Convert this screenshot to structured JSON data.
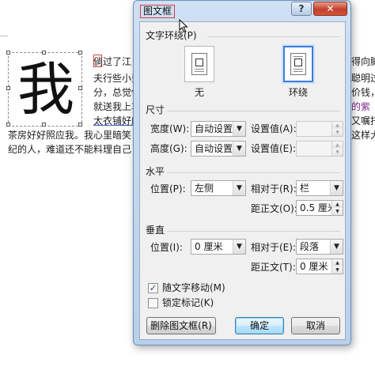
{
  "document": {
    "frame_char": "我",
    "lines": [
      "倘过了江，",
      "夫行些小费",
      "分，总觉他",
      "就送我上车",
      "太衣铺好座",
      "茶房好好照应我。我心里暗笑",
      "纪的人，难道还不能料理自己"
    ],
    "right_fragments": [
      "得向脚",
      "聪明过",
      "价钱，",
      "的紫",
      "又嘱托",
      "这样大",
      ""
    ]
  },
  "dialog": {
    "title": "图文框",
    "help_label": "?",
    "close_label": "✕",
    "wrap_section": "文字环绕(P)",
    "wrap_options": [
      {
        "label": "无",
        "selected": false
      },
      {
        "label": "环绕",
        "selected": true
      }
    ],
    "size_section": "尺寸",
    "width_label": "宽度(W):",
    "width_value": "自动设置",
    "width_setting_label": "设置值(A):",
    "width_setting_value": "",
    "height_label": "高度(G):",
    "height_value": "自动设置",
    "height_setting_label": "设置值(E):",
    "height_setting_value": "",
    "horizontal_section": "水平",
    "h_position_label": "位置(P):",
    "h_position_value": "左侧",
    "h_relative_label": "相对于(R):",
    "h_relative_value": "栏",
    "h_distance_label": "距正文(O):",
    "h_distance_value": "0.5 厘米",
    "vertical_section": "垂直",
    "v_position_label": "位置(I):",
    "v_position_value": "0 厘米",
    "v_relative_label": "相对于(E):",
    "v_relative_value": "段落",
    "v_distance_label": "距正文(T):",
    "v_distance_value": "0 厘米",
    "move_with_text_label": "随文字移动(M)",
    "move_with_text_checked": true,
    "lock_anchor_label": "锁定标记(K)",
    "lock_anchor_checked": false,
    "remove_frame_label": "删除图文框(R)",
    "ok_label": "确定",
    "cancel_label": "取消"
  }
}
